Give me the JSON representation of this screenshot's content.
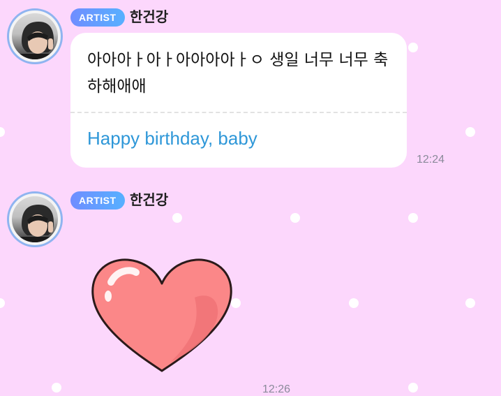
{
  "colors": {
    "background": "#fcd7fc",
    "bubble": "#ffffff",
    "badge_gradient_start": "#6f8dff",
    "badge_gradient_end": "#57b0ff",
    "translation_text": "#2e97d8",
    "timestamp": "#8a8a9a",
    "heart_fill": "#fb8788"
  },
  "messages": [
    {
      "badge": "ARTIST",
      "sender": "한건강",
      "text": "아아아ㅏ아ㅏ아아아아ㅏㅇ 생일 너무 너무 축하해애애",
      "translation": "Happy birthday, baby",
      "time": "12:24"
    },
    {
      "badge": "ARTIST",
      "sender": "한건강",
      "sticker": "heart-sticker",
      "time": "12:26"
    }
  ]
}
